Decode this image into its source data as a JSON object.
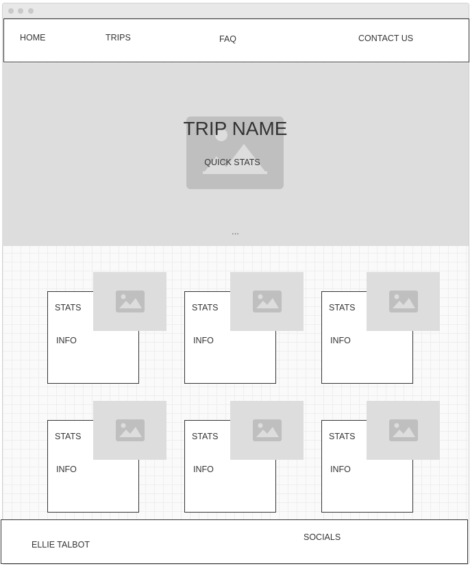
{
  "nav": {
    "home": "HOME",
    "trips": "TRIPS",
    "faq": "FAQ",
    "contact": "CONTACT US"
  },
  "hero": {
    "title": "TRIP NAME",
    "quick_stats": "QUICK STATS",
    "more": "...",
    "image_icon": "image-placeholder-icon"
  },
  "cards": [
    {
      "stats": "STATS",
      "info": "INFO"
    },
    {
      "stats": "STATS",
      "info": "INFO"
    },
    {
      "stats": "STATS",
      "info": "INFO"
    },
    {
      "stats": "STATS",
      "info": "INFO"
    },
    {
      "stats": "STATS",
      "info": "INFO"
    },
    {
      "stats": "STATS",
      "info": "INFO"
    }
  ],
  "footer": {
    "name": "ELLIE TALBOT",
    "socials": "SOCIALS"
  },
  "colors": {
    "placeholder_bg": "#dddddd",
    "placeholder_icon": "#bfbfbf",
    "border": "#333333"
  }
}
